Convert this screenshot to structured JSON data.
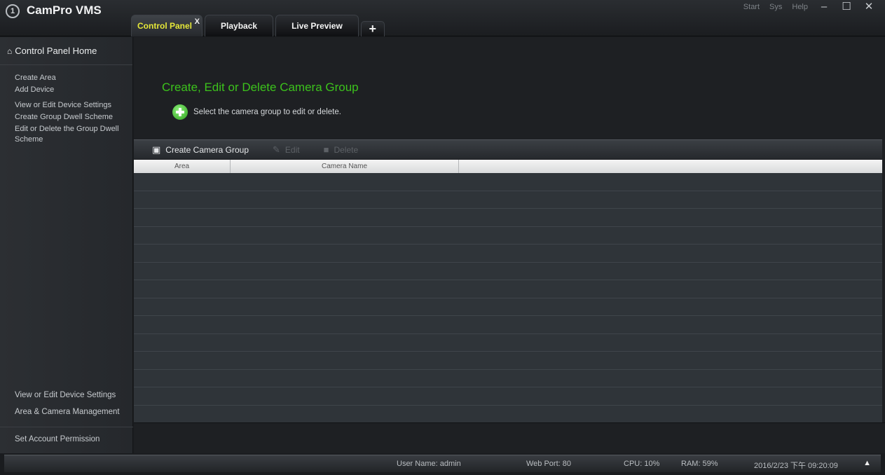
{
  "app": {
    "title": "CamPro VMS",
    "logo_glyph": "1"
  },
  "window_controls": {
    "links": [
      "Start",
      "Sys",
      "Help"
    ],
    "minimize": "–",
    "maximize": "☐",
    "close": "✕"
  },
  "tabs": [
    {
      "label": "Control Panel",
      "active": true,
      "close": "X"
    },
    {
      "label": "Playback",
      "active": false
    },
    {
      "label": "Live Preview",
      "active": false
    }
  ],
  "tab_add": "+",
  "sidebar": {
    "home_label": "Control Panel Home",
    "items": [
      "Create Area",
      "Add Device",
      "View or Edit Device Settings",
      "Create Group Dwell Scheme",
      "Edit or Delete the Group Dwell Scheme"
    ],
    "bottom_items": [
      "View or Edit Device Settings",
      "Area & Camera Management"
    ],
    "last_item": "Set Account Permission"
  },
  "main": {
    "title": "Create, Edit or Delete Camera Group",
    "tip": "Select the camera group to edit or delete.",
    "toolbar": {
      "create": "Create Camera Group",
      "edit": "Edit",
      "delete": "Delete"
    },
    "columns": {
      "area": "Area",
      "camera_name": "Camera Name"
    }
  },
  "status": {
    "user": "User Name: admin",
    "web_port": "Web Port: 80",
    "cpu": "CPU: 10%",
    "ram": "RAM: 59%",
    "datetime": "2016/2/23 下午 09:20:09",
    "toggle": "▲"
  },
  "colors": {
    "accent_green": "#3cc21c",
    "active_tab_text": "#e6e838"
  }
}
